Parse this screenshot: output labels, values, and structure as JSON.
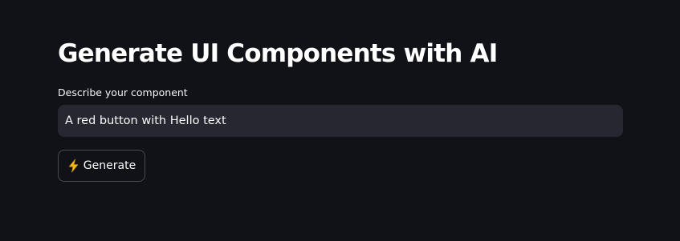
{
  "page": {
    "title": "Generate UI Components with AI"
  },
  "form": {
    "description_label": "Describe your component",
    "description_value": "A red button with Hello text"
  },
  "actions": {
    "generate_label": "Generate",
    "generate_icon": "lightning-icon"
  },
  "colors": {
    "background": "#111217",
    "input_background": "#262730",
    "button_border": "#474a55",
    "lightning": "#f7bf13",
    "text": "#fafafa"
  }
}
